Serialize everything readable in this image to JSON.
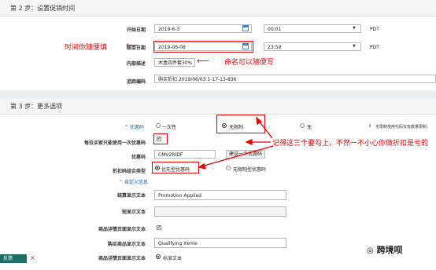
{
  "step2": {
    "title": "第 2 步：设置促销时间",
    "start_label": "开始日期",
    "start_date": "2019-6-3",
    "start_time": "00:01",
    "end_label": "结束日期",
    "end_date": "2019-06-08",
    "end_time": "23:59",
    "timezone": "PDT",
    "internal_desc_label": "内部描述",
    "internal_desc_value": "木盒四件套30%",
    "tracking_label": "追踪编码",
    "tracking_value": "购买折扣 2019/06/03 1-17-13-836"
  },
  "step3": {
    "title": "第 3 步：更多选项",
    "claim_code_label": "^ 优惠码",
    "claim_once": "一次性",
    "claim_unlimited": "无限制",
    "claim_none": "无",
    "claim_hint": "无限制使用代码仅有数量限制。",
    "per_customer_label": "每位买家只能使用一次优惠码",
    "per_customer_checked": "✔",
    "coupon_label": "优惠码",
    "coupon_value": "CMV2RIDF",
    "suggest_button": "建议一个优惠码",
    "combo_label": "折扣码组合类型",
    "combo_priority": "优先型优惠码",
    "combo_unlimited": "无限制型优惠码",
    "custom_info_link": "^ 自定义信息",
    "checkout_label": "结算显示文本",
    "checkout_value": "Promotion Applied",
    "short_label": "短显示文本",
    "short_value": "",
    "detail_display_label": "商品详情页面显示文本",
    "detail_display_checked": "✔",
    "purchase_label": "购买商品显示文本",
    "purchase_value": "Qualifying Items",
    "detail_page_label": "商品详情页面显示文本",
    "detail_page_option": "标准文本"
  },
  "annotations": {
    "time_note": "时间你随便填",
    "name_note": "命名可以随便写",
    "check_note": "记得这三个要勾上，不然一不小心你做折扣是亏的"
  },
  "footer": {
    "feedback": "反馈",
    "close": "×"
  },
  "watermark": "跨境呗",
  "colors": {
    "annotation": "#e60000",
    "link": "#1a5ea8"
  }
}
